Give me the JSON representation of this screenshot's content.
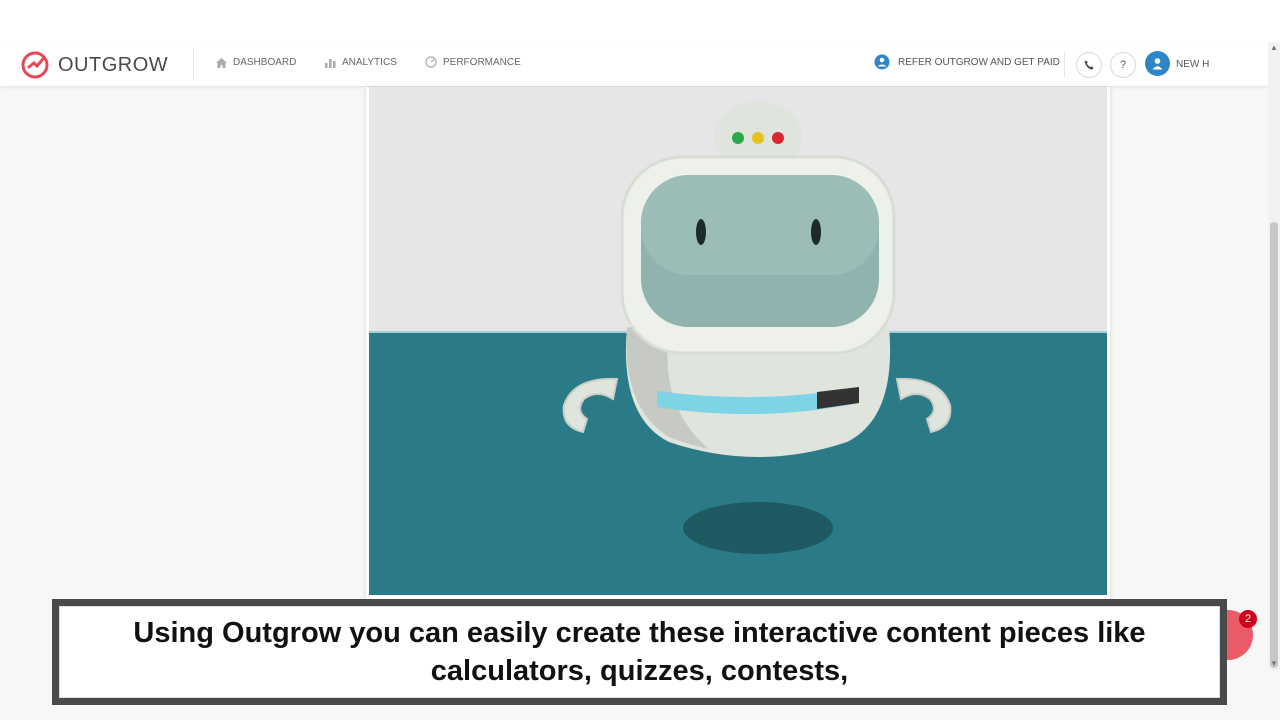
{
  "app": {
    "name": "OUTGROW"
  },
  "nav": {
    "dashboard": "DASHBOARD",
    "analytics": "ANALYTICS",
    "performance": "PERFORMANCE",
    "refer": "REFER OUTGROW AND GET PAID",
    "help": "?",
    "user": "NEW H"
  },
  "icons": {
    "phone": "phone-icon",
    "help": "question-icon",
    "user": "user-icon",
    "home": "home-icon",
    "analytics": "bar-chart-icon",
    "performance": "gauge-icon",
    "refer": "refer-icon"
  },
  "colors": {
    "brand": "#e84856",
    "accent": "#2f86c6",
    "video_top": "#e6e6e6",
    "video_floor": "#2a7a87"
  },
  "caption": {
    "text": "Using Outgrow you can easily create these interactive content pieces like calculators, quizzes, contests,"
  },
  "chat": {
    "badge_count": "2"
  }
}
